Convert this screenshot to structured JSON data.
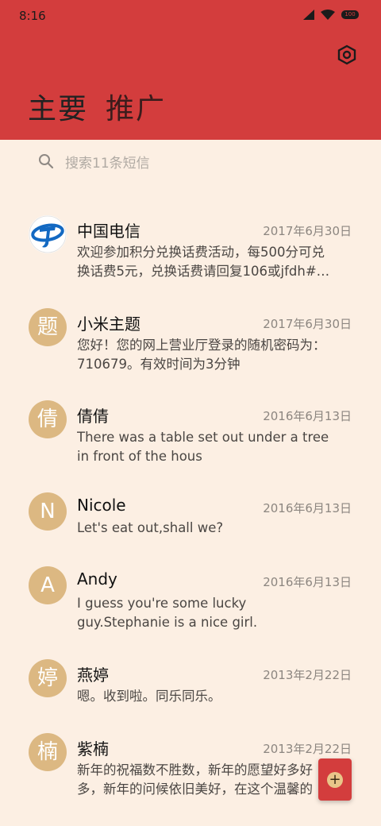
{
  "status": {
    "time": "8:16",
    "battery": "100"
  },
  "header": {
    "tabs": [
      "主要",
      "推广"
    ]
  },
  "search": {
    "placeholder": "搜索11条短信"
  },
  "messages": [
    {
      "sender": "中国电信",
      "date": "2017年6月30日",
      "preview": "欢迎参加积分兑换话费活动，每500分可兑\n换话费5元，兑换话费请回复106或jfdh#…",
      "avatar": ""
    },
    {
      "sender": "小米主题",
      "date": "2017年6月30日",
      "preview": "您好！您的网上营业厅登录的随机密码为：\n710679。有效时间为3分钟",
      "avatar": "题"
    },
    {
      "sender": "倩倩",
      "date": "2016年6月13日",
      "preview": "There was a table set out under a tree\nin front of the hous",
      "avatar": "倩"
    },
    {
      "sender": "Nicole",
      "date": "2016年6月13日",
      "preview": "Let's eat out,shall we?",
      "avatar": "N"
    },
    {
      "sender": "Andy",
      "date": "2016年6月13日",
      "preview": "I guess you're some lucky\nguy.Stephanie is a nice girl.",
      "avatar": "A"
    },
    {
      "sender": "燕婷",
      "date": "2013年2月22日",
      "preview": "嗯。收到啦。同乐同乐。",
      "avatar": "婷"
    },
    {
      "sender": "紫楠",
      "date": "2013年2月22日",
      "preview": "新年的祝福数不胜数，新年的愿望好多好\n多，新年的问候依旧美好，在这个温馨的",
      "avatar": "楠"
    }
  ],
  "fab": {
    "icon": "+"
  },
  "colors": {
    "header": "#d33d3d",
    "background": "#fcefe3",
    "avatar": "#dcb882"
  }
}
